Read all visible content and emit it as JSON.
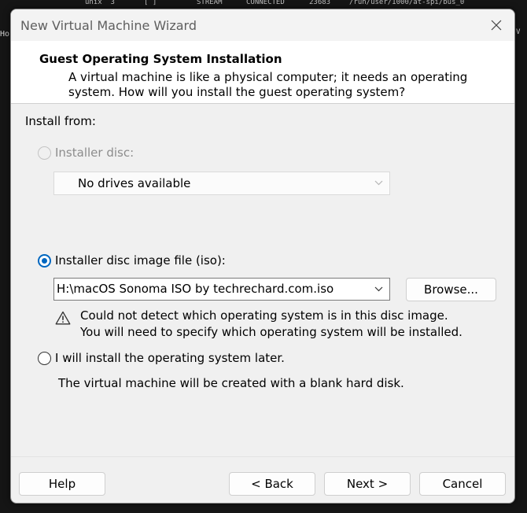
{
  "background": {
    "terminal_line": [
      "unix  3",
      "[ ]",
      "STREAM",
      "CONNECTED",
      "23683",
      "/run/user/1000/at-spi/bus_0"
    ],
    "left_text": "Ho",
    "right_text": "V"
  },
  "window": {
    "title": "New Virtual Machine Wizard",
    "header": {
      "title": "Guest Operating System Installation",
      "description": "A virtual machine is like a physical computer; it needs an operating system. How will you install the guest operating system?"
    },
    "install_from_label": "Install from:",
    "options": {
      "installer_disc": {
        "label": "Installer disc:",
        "selected": false,
        "enabled": false,
        "drive_value": "No drives available"
      },
      "iso": {
        "label": "Installer disc image file (iso):",
        "selected": true,
        "path_value": "H:\\macOS Sonoma ISO  by techrechard.com.iso",
        "browse_label": "Browse...",
        "warning_line1": "Could not detect which operating system is in this disc image.",
        "warning_line2": "You will need to specify which operating system will be installed."
      },
      "later": {
        "label": "I will install the operating system later.",
        "selected": false,
        "note": "The virtual machine will be created with a blank hard disk."
      }
    },
    "buttons": {
      "help": "Help",
      "back": "< Back",
      "next": "Next >",
      "cancel": "Cancel"
    }
  },
  "colors": {
    "accent": "#0067c0",
    "window_bg": "#f0f0f0",
    "header_bg": "#ffffff",
    "disabled_text": "#8c8c8c"
  },
  "icons": [
    "close-icon",
    "chevron-down-icon",
    "warning-triangle-icon"
  ]
}
